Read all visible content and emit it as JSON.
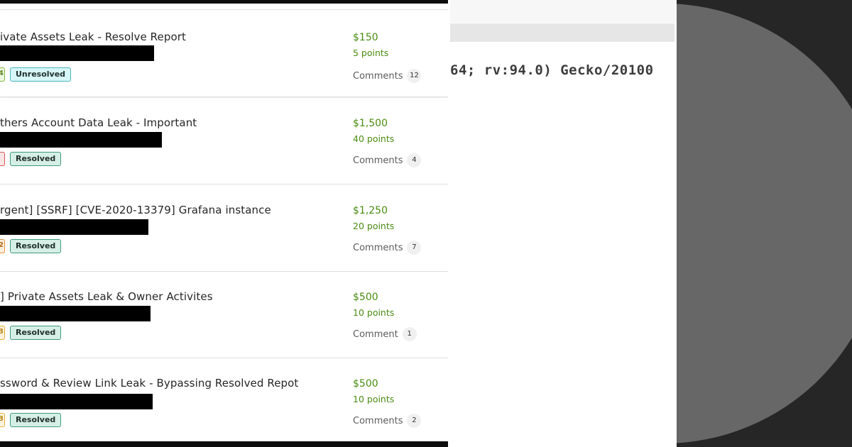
{
  "reports": [
    {
      "title": "ivate Assets Leak - Resolve Report",
      "tag_cut_text": "4",
      "tag_cut_color": "#7fb53d",
      "status": "Unresolved",
      "bounty": "$150",
      "points": "5 points",
      "comments_label": "Comments",
      "comments_count": "12"
    },
    {
      "title": "thers Account Data Leak - Important",
      "tag_cut_text": "",
      "tag_cut_color": "#d9534f",
      "status": "Resolved",
      "bounty": "$1,500",
      "points": "40 points",
      "comments_label": "Comments",
      "comments_count": "4"
    },
    {
      "title": "rgent] [SSRF] [CVE-2020-13379] Grafana instance",
      "tag_cut_text": "2",
      "tag_cut_color": "#e8913b",
      "status": "Resolved",
      "bounty": "$1,250",
      "points": "20 points",
      "comments_label": "Comments",
      "comments_count": "7"
    },
    {
      "title": "] Private Assets Leak & Owner Activites",
      "tag_cut_text": "3",
      "tag_cut_color": "#e8b13b",
      "status": "Resolved",
      "bounty": "$500",
      "points": "10 points",
      "comments_label": "Comment",
      "comments_count": "1"
    },
    {
      "title": "ssword & Review Link Leak - Bypassing Resolved Repot",
      "tag_cut_text": "3",
      "tag_cut_color": "#e8b13b",
      "status": "Resolved",
      "bounty": "$500",
      "points": "10 points",
      "comments_label": "Comments",
      "comments_count": "2"
    }
  ],
  "terminal": {
    "user_agent_fragment": "64; rv:94.0) Gecko/20100"
  },
  "colors": {
    "money_green": "#4a8c12",
    "unresolved_bg": "#d7f6f8",
    "resolved_bg": "#d6efe6",
    "right_background": "#262626",
    "circle": "#676767"
  }
}
